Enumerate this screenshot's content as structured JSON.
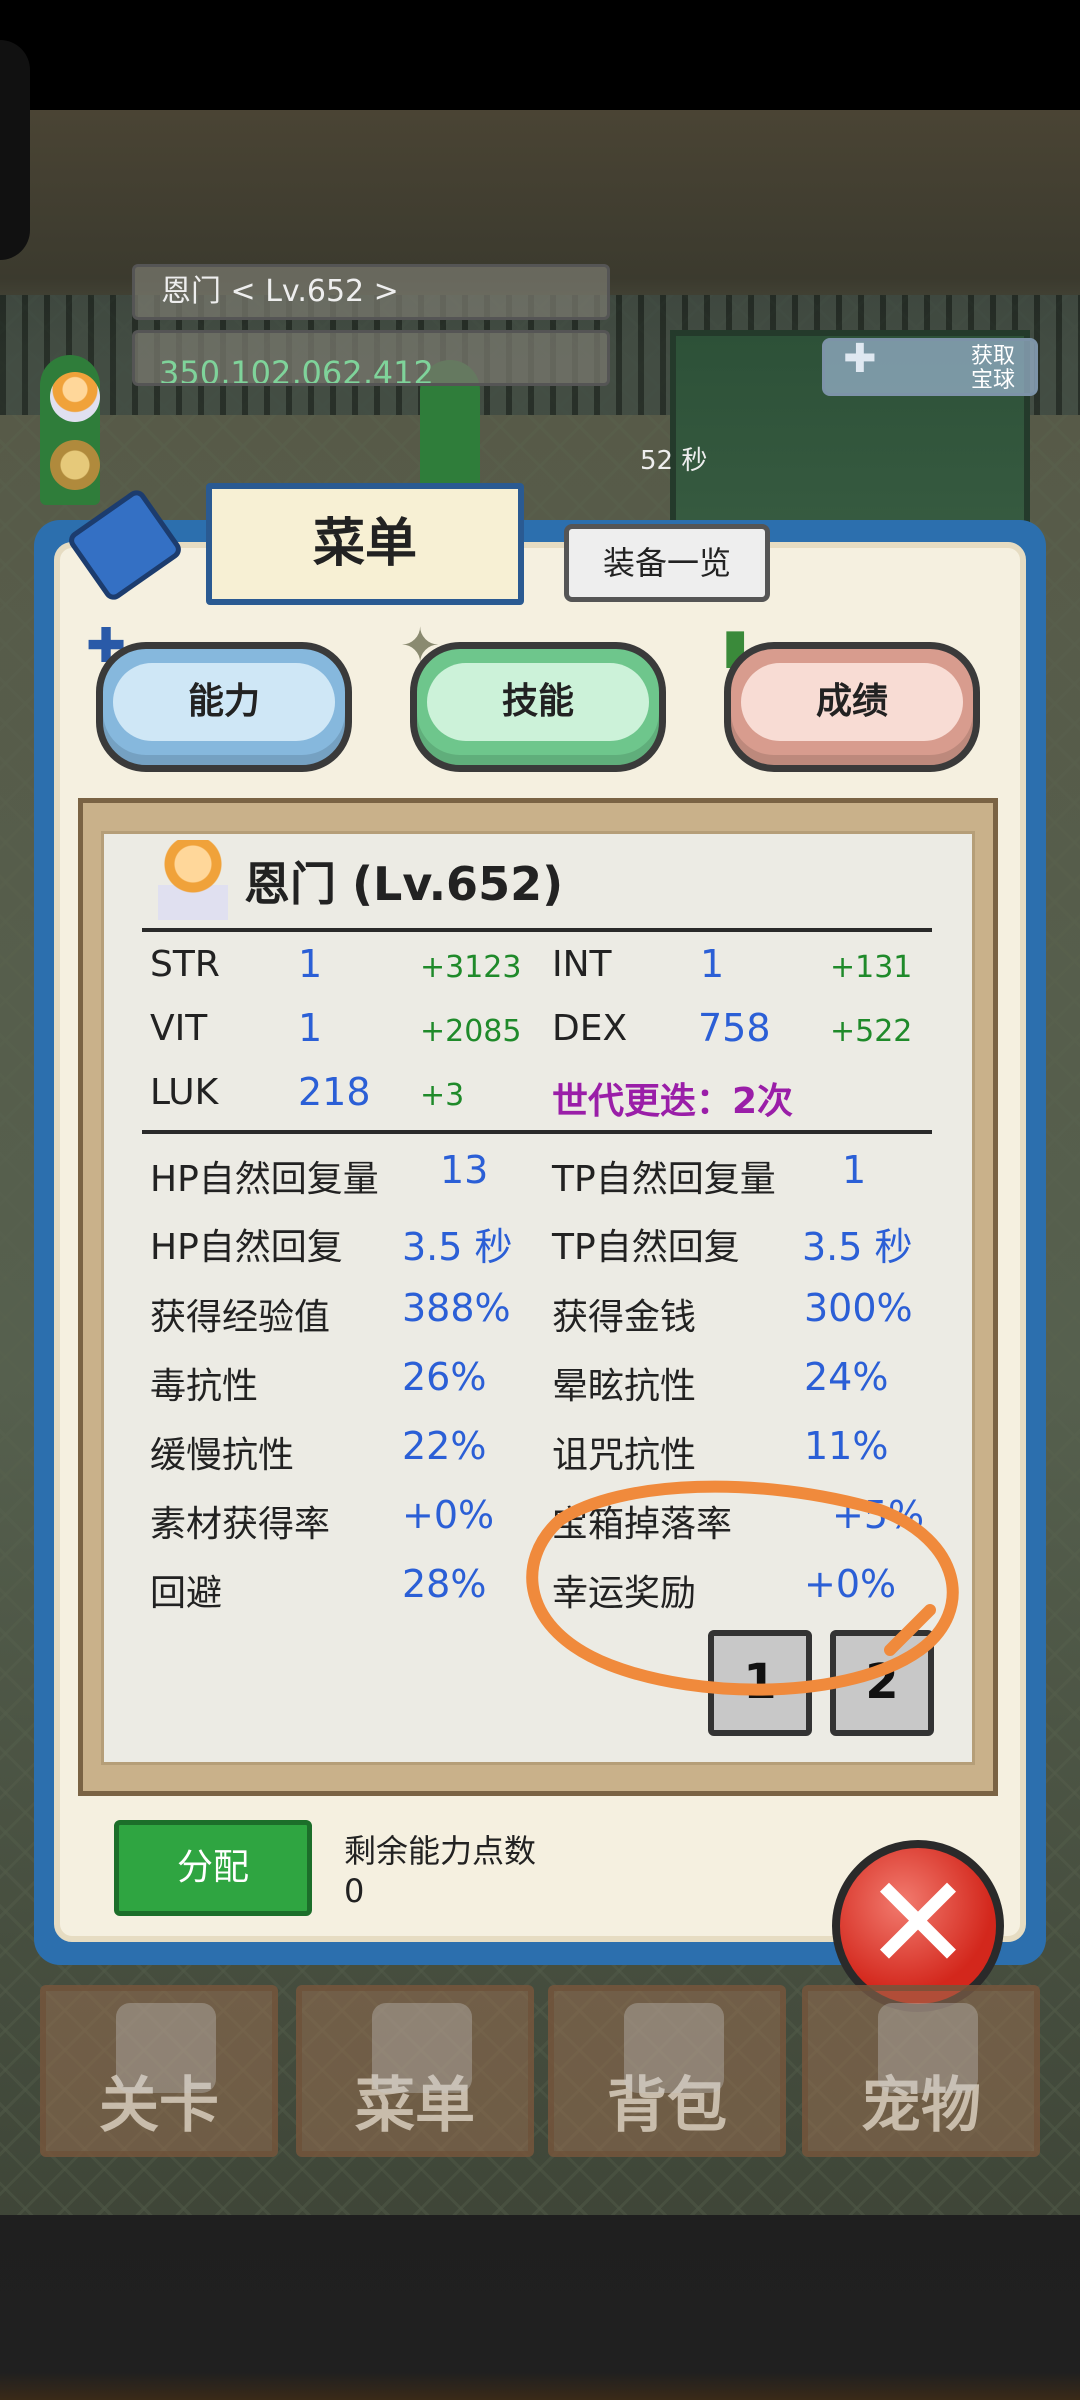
{
  "hud": {
    "name_level": "恩门   < Lv.652 >",
    "gold": "350,102,062,412",
    "timer": "52 秒",
    "boost_label": "获取\n宝球"
  },
  "menu": {
    "title": "菜单",
    "equip_list": "装备一览",
    "tabs": [
      {
        "label": "能力"
      },
      {
        "label": "技能"
      },
      {
        "label": "成绩"
      }
    ]
  },
  "character": {
    "title": "恩门 (Lv.652)"
  },
  "base_stats": [
    {
      "label": "STR",
      "value": "1",
      "bonus": "+3123"
    },
    {
      "label": "INT",
      "value": "1",
      "bonus": "+131"
    },
    {
      "label": "VIT",
      "value": "1",
      "bonus": "+2085"
    },
    {
      "label": "DEX",
      "value": "758",
      "bonus": "+522"
    },
    {
      "label": "LUK",
      "value": "218",
      "bonus": "+3"
    }
  ],
  "generation": "世代更迭：2次",
  "derived_stats": [
    {
      "label": "HP自然回复量",
      "value": "13"
    },
    {
      "label": "TP自然回复量",
      "value": "1"
    },
    {
      "label": "HP自然回复",
      "value": "3.5 秒"
    },
    {
      "label": "TP自然回复",
      "value": "3.5 秒"
    },
    {
      "label": "获得经验值",
      "value": "388%"
    },
    {
      "label": "获得金钱",
      "value": "300%"
    },
    {
      "label": "毒抗性",
      "value": "26%"
    },
    {
      "label": "晕眩抗性",
      "value": "24%"
    },
    {
      "label": "缓慢抗性",
      "value": "22%"
    },
    {
      "label": "诅咒抗性",
      "value": "11%"
    },
    {
      "label": "素材获得率",
      "value": "+0%"
    },
    {
      "label": "宝箱掉落率",
      "value": "+5%"
    },
    {
      "label": "回避",
      "value": "28%"
    },
    {
      "label": "幸运奖励",
      "value": "+0%"
    }
  ],
  "pages": [
    "1",
    "2"
  ],
  "allocate": {
    "button": "分配",
    "remaining_label": "剩余能力点数",
    "remaining_value": "0"
  },
  "close_glyph": "✕",
  "nav": [
    {
      "label": "关卡"
    },
    {
      "label": "菜单"
    },
    {
      "label": "背包"
    },
    {
      "label": "宠物"
    }
  ],
  "colors": {
    "panel_blue": "#2c6fae",
    "stat_value_blue": "#2b5fd6",
    "bonus_green": "#1f8a2a",
    "generation_purple": "#9a1ea8",
    "annotation_orange": "#f08a3c"
  }
}
